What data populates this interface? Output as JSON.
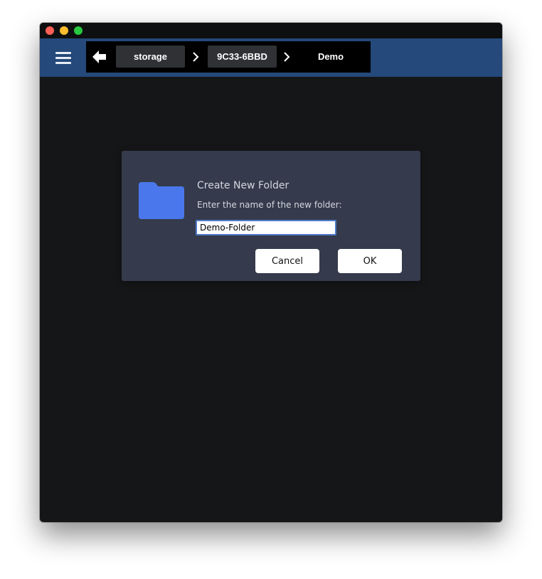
{
  "window": {
    "colors": {
      "toolbar": "#24497a",
      "content": "#151618",
      "dialog": "#353b4c",
      "folder": "#4a78ec"
    }
  },
  "toolbar": {
    "menu_icon": "hamburger-menu-icon",
    "back_icon": "arrow-left-icon",
    "breadcrumb": [
      "storage",
      "9C33-6BBD",
      "Demo"
    ],
    "separator_icon": "chevron-right-icon"
  },
  "dialog": {
    "icon": "folder-icon",
    "title": "Create New Folder",
    "message": "Enter the name of the new folder:",
    "input_value": "Demo-Folder",
    "cancel_label": "Cancel",
    "ok_label": "OK"
  }
}
